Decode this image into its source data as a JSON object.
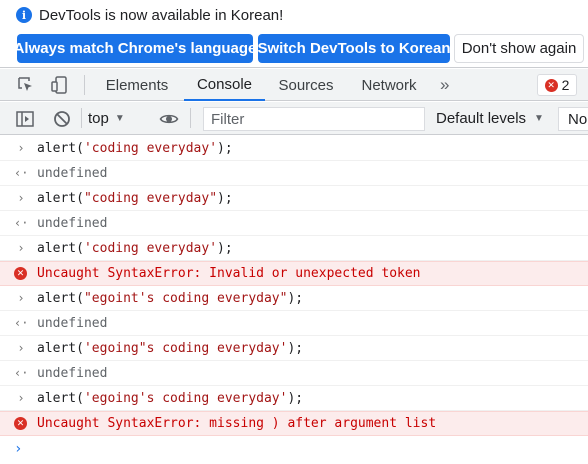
{
  "infobar": {
    "message": "DevTools is now available in Korean!",
    "icon": "info-icon",
    "buttons": {
      "match": "Always match Chrome's language",
      "switch": "Switch DevTools to Korean",
      "dont_show": "Don't show again"
    }
  },
  "tabs": {
    "items": [
      "Elements",
      "Console",
      "Sources",
      "Network"
    ],
    "active": "Console",
    "more": "»",
    "error_count": "2"
  },
  "toolbar": {
    "context": "top",
    "filter_placeholder": "Filter",
    "levels": "Default levels",
    "no_issues": "No"
  },
  "console": {
    "entries": [
      {
        "type": "input",
        "pre": "alert(",
        "str": "'coding everyday'",
        "post": ");"
      },
      {
        "type": "result",
        "text": "undefined"
      },
      {
        "type": "input",
        "pre": "alert(",
        "str": "\"coding everyday\"",
        "post": ");"
      },
      {
        "type": "result",
        "text": "undefined"
      },
      {
        "type": "input",
        "pre": "alert(",
        "str": "'coding everyday'",
        "post": ");"
      },
      {
        "type": "error",
        "text": "Uncaught SyntaxError: Invalid or unexpected token"
      },
      {
        "type": "input",
        "pre": "alert(",
        "str": "\"egoint's coding everyday\"",
        "post": ");"
      },
      {
        "type": "result",
        "text": "undefined"
      },
      {
        "type": "input",
        "pre": "alert(",
        "str": "'egoing\"s coding everyday'",
        "post": ");"
      },
      {
        "type": "result",
        "text": "undefined"
      },
      {
        "type": "input",
        "pre": "alert(",
        "str": "'egoing's coding everyday'",
        "post": ");"
      },
      {
        "type": "error",
        "text": "Uncaught SyntaxError: missing ) after argument list"
      }
    ],
    "input_arrow": "›",
    "result_arrow": "‹·",
    "prompt": "›"
  },
  "colors": {
    "accent": "#1a73e8",
    "error": "#d93025",
    "error_bg": "#fcecec",
    "string": "#a31515"
  }
}
